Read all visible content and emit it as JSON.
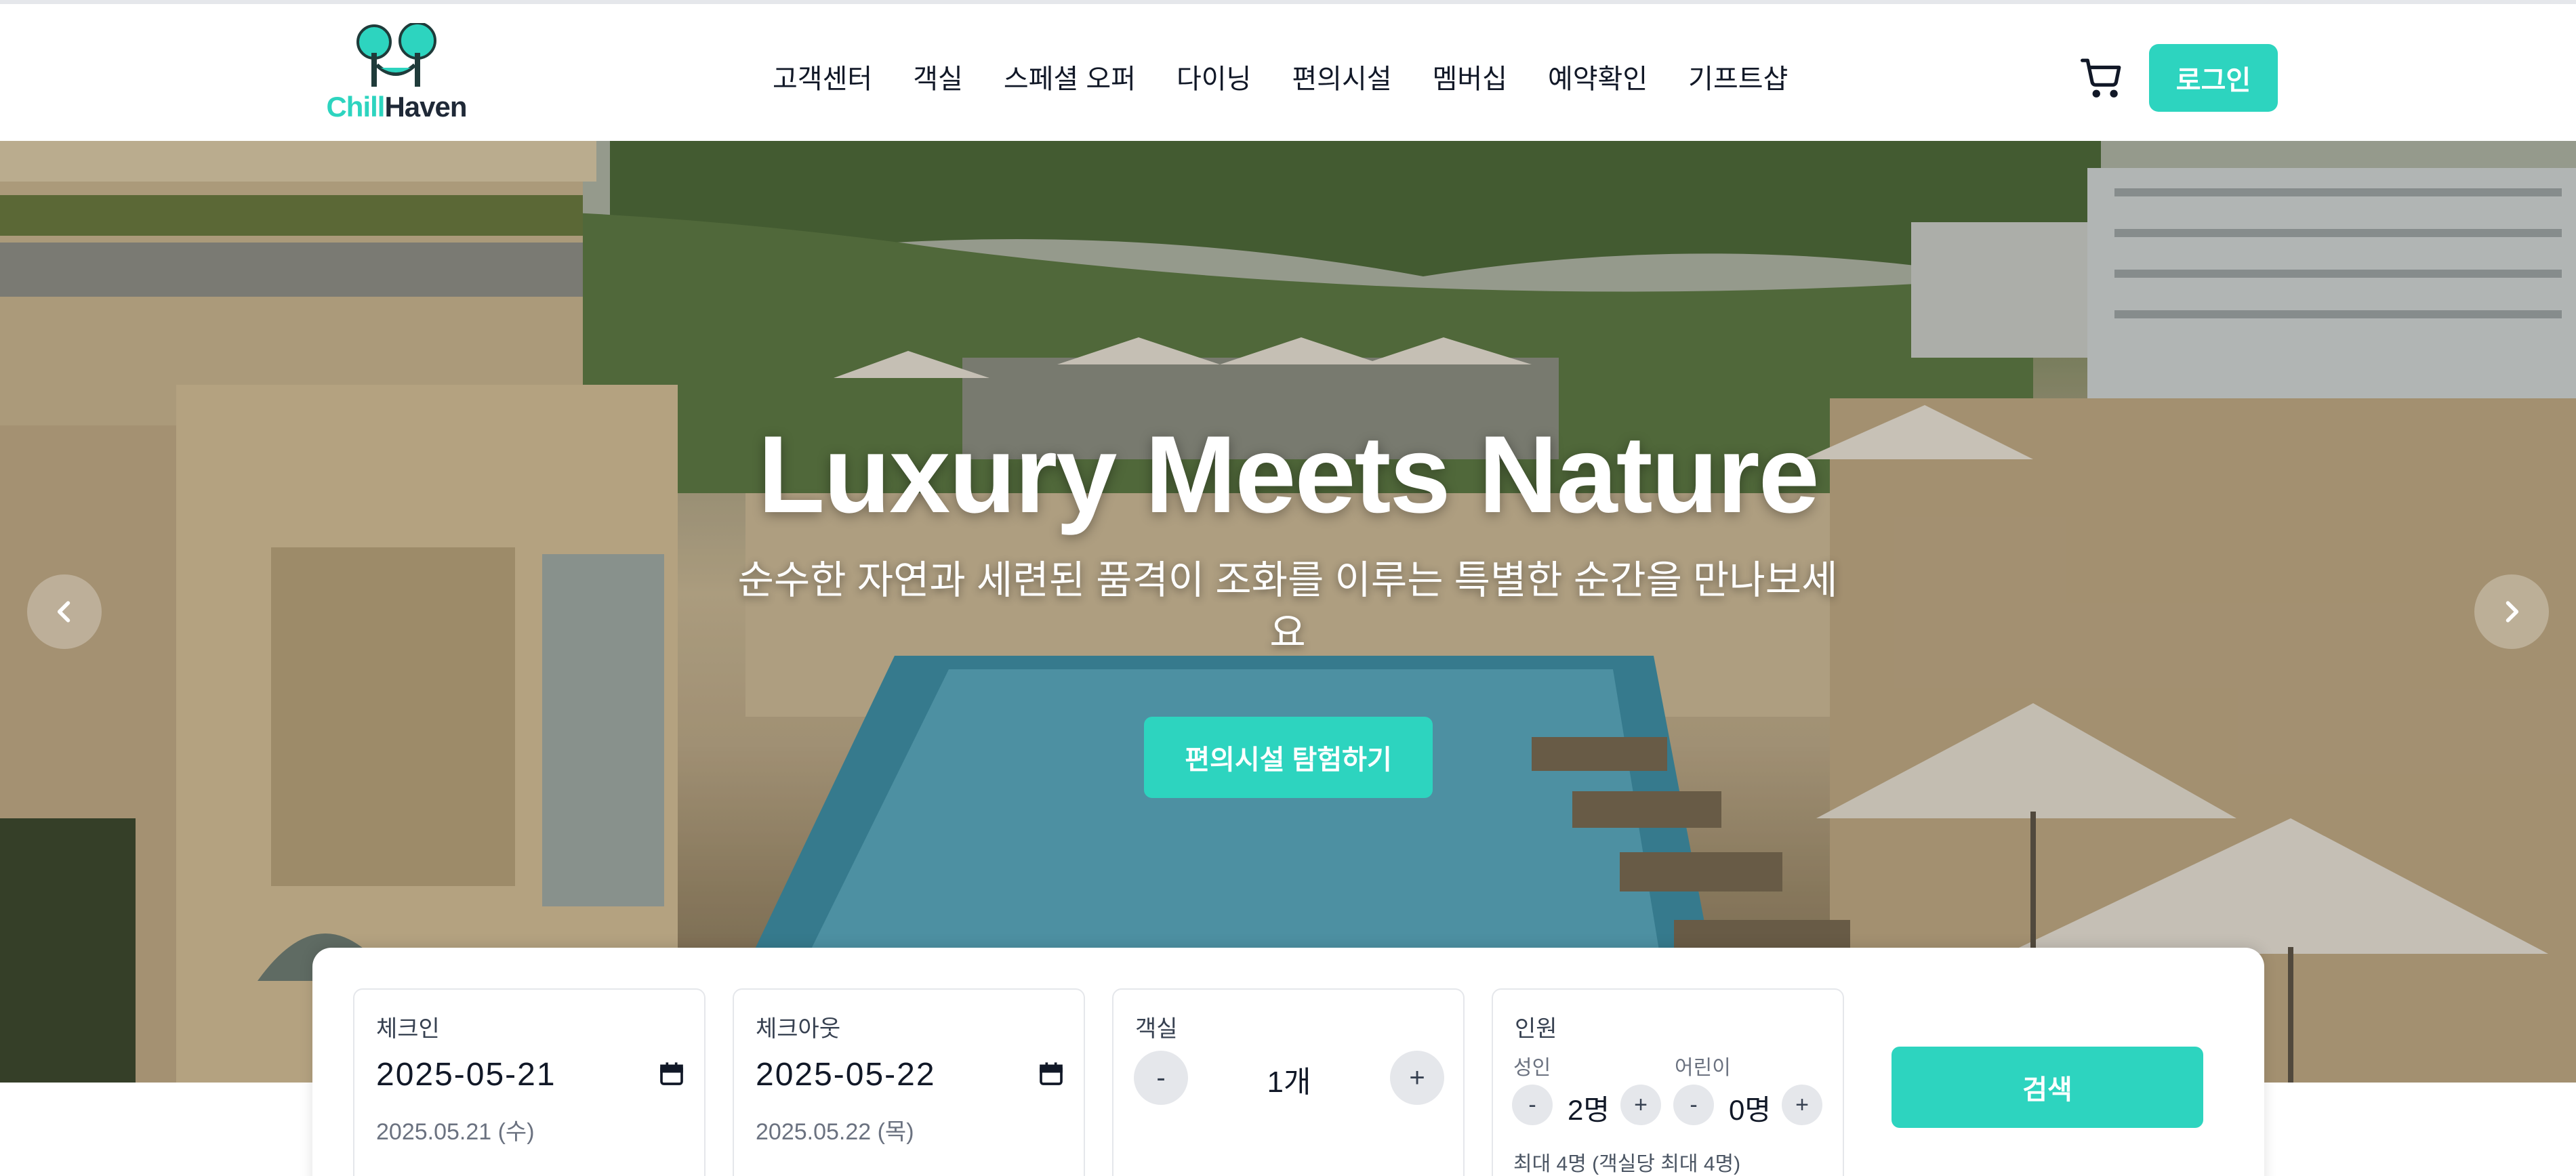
{
  "header": {
    "logo": {
      "part1": "Chill",
      "part2": "Haven"
    },
    "nav": [
      "고객센터",
      "객실",
      "스페셜 오퍼",
      "다이닝",
      "편의시설",
      "멤버십",
      "예약확인",
      "기프트샵"
    ],
    "cart_icon": "cart-icon",
    "login_label": "로그인"
  },
  "hero": {
    "title": "Luxury Meets Nature",
    "subtitle": "순수한 자연과 세련된 품격이 조화를 이루는 특별한 순간을 만나보세요",
    "cta_label": "편의시설 탐험하기",
    "prev_icon": "chevron-left-icon",
    "next_icon": "chevron-right-icon"
  },
  "booking": {
    "checkin": {
      "label": "체크인",
      "value": "2025-05-21",
      "display": "2025.05.21 (수)"
    },
    "checkout": {
      "label": "체크아웃",
      "value": "2025-05-22",
      "display": "2025.05.22 (목)"
    },
    "rooms": {
      "label": "객실",
      "minus": "-",
      "value": "1개",
      "plus": "+"
    },
    "guests": {
      "label": "인원",
      "adult_label": "성인",
      "adult_value": "2명",
      "child_label": "어린이",
      "child_value": "0명",
      "minus": "-",
      "plus": "+",
      "note": "최대 4명 (객실당 최대 4명)"
    },
    "search_label": "검색"
  },
  "colors": {
    "accent": "#2dd4bf",
    "text": "#111827"
  }
}
